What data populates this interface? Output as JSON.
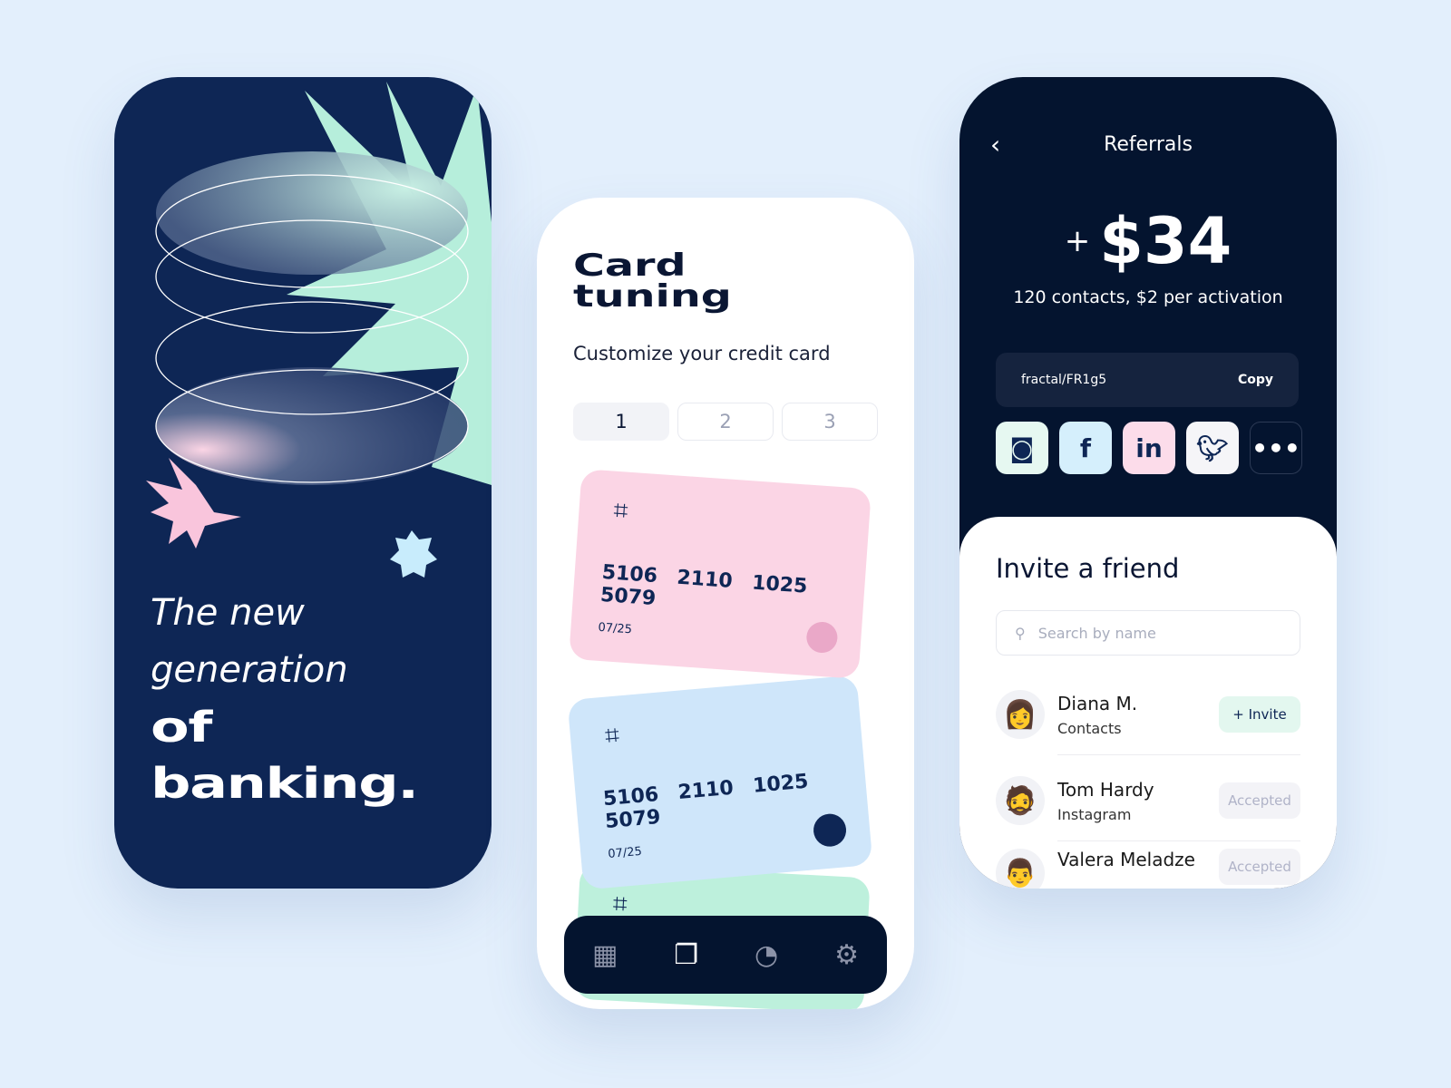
{
  "hero": {
    "line1": "The new",
    "line2": "generation",
    "line3": "of",
    "line4": "banking."
  },
  "card_tuning": {
    "title1": "Card",
    "title2": "tuning",
    "subtitle": "Customize your credit card",
    "steps": [
      "1",
      "2",
      "3"
    ],
    "cards": [
      {
        "number": "5106 2110 1025 5079",
        "expiry": "07/25",
        "color": "#fbd5e5"
      },
      {
        "number": "5106 2110 1025 5079",
        "expiry": "07/25",
        "color": "#cfe6fa"
      },
      {
        "color": "#bdf0dc"
      }
    ],
    "nav": [
      {
        "icon": "grid-icon"
      },
      {
        "icon": "cards-icon",
        "active": true
      },
      {
        "icon": "pie-chart-icon"
      },
      {
        "icon": "gear-icon"
      }
    ]
  },
  "referrals": {
    "title": "Referrals",
    "plus": "+",
    "amount": "$34",
    "description": "120 contacts, $2 per activation",
    "code": "fractal/FR1g5",
    "copy": "Copy",
    "social": [
      {
        "icon": "instagram-icon",
        "color": "#e6f8f1"
      },
      {
        "icon": "facebook-icon",
        "color": "#d5effc"
      },
      {
        "icon": "linkedin-icon",
        "color": "#fcdcea"
      },
      {
        "icon": "twitter-icon",
        "color": "#f5f5f8"
      },
      {
        "icon": "more-icon"
      }
    ],
    "invite_title": "Invite a friend",
    "search_placeholder": "Search by name",
    "friends": [
      {
        "name": "Diana M.",
        "source": "Contacts",
        "action": "+ Invite"
      },
      {
        "name": "Tom Hardy",
        "source": "Instagram",
        "action": "Accepted"
      },
      {
        "name": "Valera Meladze",
        "source": "",
        "action": "Accepted"
      }
    ]
  }
}
